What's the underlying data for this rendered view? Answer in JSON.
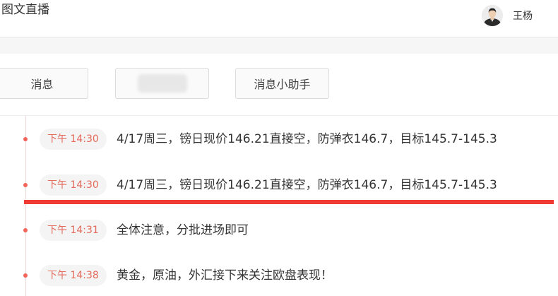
{
  "header": {
    "title": "图文直播",
    "user_name": "王杨"
  },
  "tabs": [
    {
      "label": "消息"
    },
    {
      "label": ""
    },
    {
      "label": "消息小助手"
    }
  ],
  "messages": [
    {
      "time": "下午 14:30",
      "text": "4/17周三，镑日现价146.21直接空，防弹衣146.7，目标145.7-145.3"
    },
    {
      "time": "下午 14:30",
      "text": "4/17周三，镑日现价146.21直接空，防弹衣146.7，目标145.7-145.3"
    },
    {
      "time": "下午 14:31",
      "text": "全体注意，分批进场即可"
    },
    {
      "time": "下午 14:38",
      "text": "黄金，原油，外汇接下来关注欧盘表现！"
    }
  ],
  "colors": {
    "accent_red": "#f03a34",
    "time_text": "#e46a5a",
    "dot": "#f0645a"
  },
  "icons": {
    "avatar": "user-avatar-photo"
  }
}
